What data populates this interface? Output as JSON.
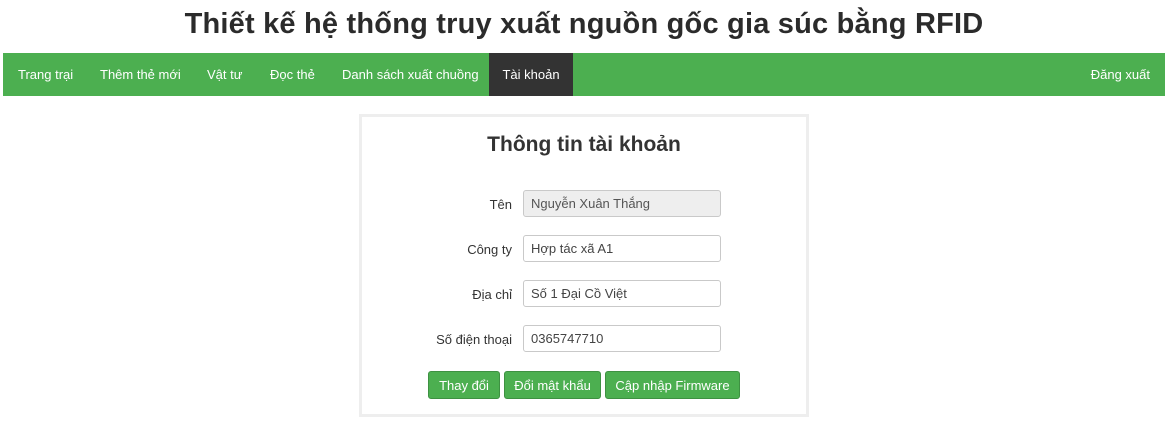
{
  "header": {
    "title": "Thiết kế hệ thống truy xuất nguồn gốc gia súc bằng RFID"
  },
  "nav": {
    "items": [
      {
        "label": "Trang trại"
      },
      {
        "label": "Thêm thẻ mới"
      },
      {
        "label": "Vật tư"
      },
      {
        "label": "Đọc thẻ"
      },
      {
        "label": "Danh sách xuất chuồng"
      },
      {
        "label": "Tài khoản"
      }
    ],
    "active": "Tài khoản",
    "logout_label": "Đăng xuất"
  },
  "account": {
    "title": "Thông tin tài khoản",
    "fields": {
      "name": {
        "label": "Tên",
        "value": "Nguyễn Xuân Thắng"
      },
      "company": {
        "label": "Công ty",
        "value": "Hợp tác xã A1"
      },
      "address": {
        "label": "Địa chỉ",
        "value": "Số 1 Đại Cồ Việt"
      },
      "phone": {
        "label": "Số điện thoại",
        "value": "0365747710"
      }
    },
    "buttons": {
      "change": "Thay đổi",
      "change_password": "Đổi mật khẩu",
      "update_firmware": "Cập nhập Firmware"
    }
  },
  "colors": {
    "nav_bg": "#4caf50",
    "nav_active_bg": "#333333",
    "button_bg": "#4caf50"
  }
}
